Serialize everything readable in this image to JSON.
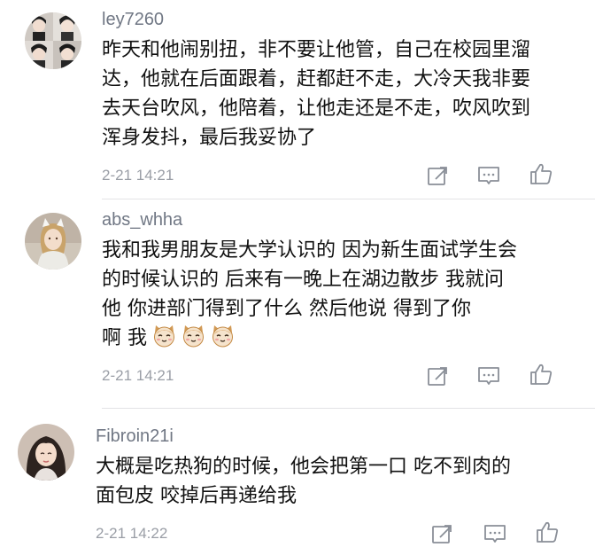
{
  "comments": [
    {
      "username": "ley7260",
      "lines": [
        "昨天和他闹别扭，非不要让他管，自己在校园里溜",
        "达，他就在后面跟着，赶都赶不走，大冷天我非要",
        "去天台吹风，他陪着，让他走还是不走，吹风吹到",
        "浑身发抖，最后我妥协了"
      ],
      "timestamp": "2-21 14:21",
      "avatar_icon": "avatar-photo-grid"
    },
    {
      "username": "abs_whha",
      "lines": [
        "我和我男朋友是大学认识的  因为新生面试学生会",
        "的时候认识的   后来有一晚上在湖边散步  我就问",
        "他   你进部门得到了什么   然后他说  得到了你",
        "啊    我"
      ],
      "emojis": [
        "cat-emoji",
        "cat-emoji",
        "cat-emoji"
      ],
      "timestamp": "2-21 14:21",
      "avatar_icon": "avatar-photo-girl-cat-ears"
    },
    {
      "username": "Fibroin21i",
      "lines": [
        "大概是吃热狗的时候，他会把第一口  吃不到肉的",
        "面包皮  咬掉后再递给我"
      ],
      "timestamp": "2-21 14:22",
      "avatar_icon": "avatar-photo-girl"
    }
  ],
  "actions": {
    "share_icon": "share-icon",
    "reply_icon": "reply-icon",
    "like_icon": "thumbs-up-icon"
  },
  "colors": {
    "username": "#707784",
    "text": "#111111",
    "timestamp": "#9a9ea6",
    "icon": "#8a8f98",
    "divider": "#e3e3e6"
  }
}
